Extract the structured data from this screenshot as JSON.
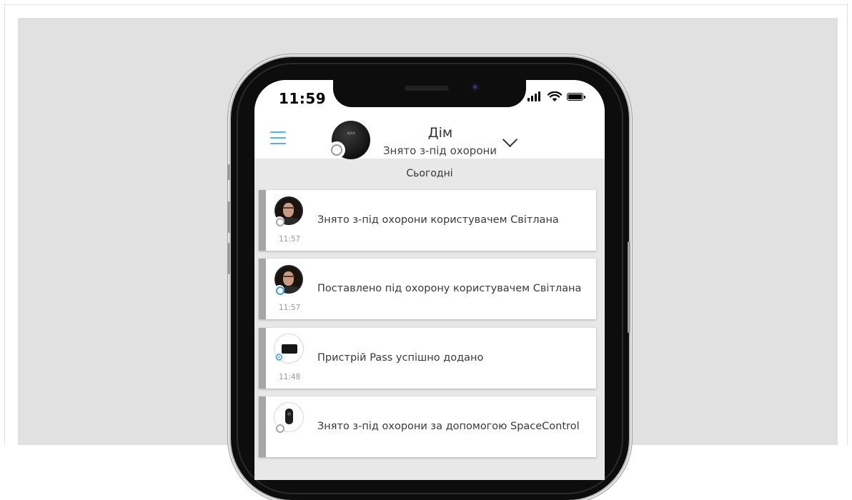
{
  "status_bar": {
    "time": "11:59"
  },
  "header": {
    "hub_logo": "AJAX",
    "hub_name": "Дім",
    "hub_state": "Знято з-під охорони"
  },
  "feed": {
    "day_label": "Сьогодні",
    "events": [
      {
        "text": "Знято з-під охорони користувачем Світлана",
        "time": "11:57",
        "icon": "user-photo",
        "status": "disarmed"
      },
      {
        "text": "Поставлено під охорону користувачем Світлана",
        "time": "11:57",
        "icon": "user-photo",
        "status": "armed"
      },
      {
        "text": "Пристрій Pass успішно додано",
        "time": "11:48",
        "icon": "pass-card",
        "status": "settings"
      },
      {
        "text": "Знято з-під охорони за допомогою SpaceControl",
        "time": "",
        "icon": "spacecontrol-fob",
        "status": "disarmed"
      }
    ]
  },
  "colors": {
    "accent": "#3b9ee3",
    "menu_icon": "#4fb2e8",
    "card_stripe": "#a6a6a6",
    "background": "#e1e1e1"
  },
  "icons": [
    "menu-icon",
    "chevron-down-icon",
    "signal-icon",
    "wifi-icon",
    "battery-icon",
    "gear-icon"
  ]
}
